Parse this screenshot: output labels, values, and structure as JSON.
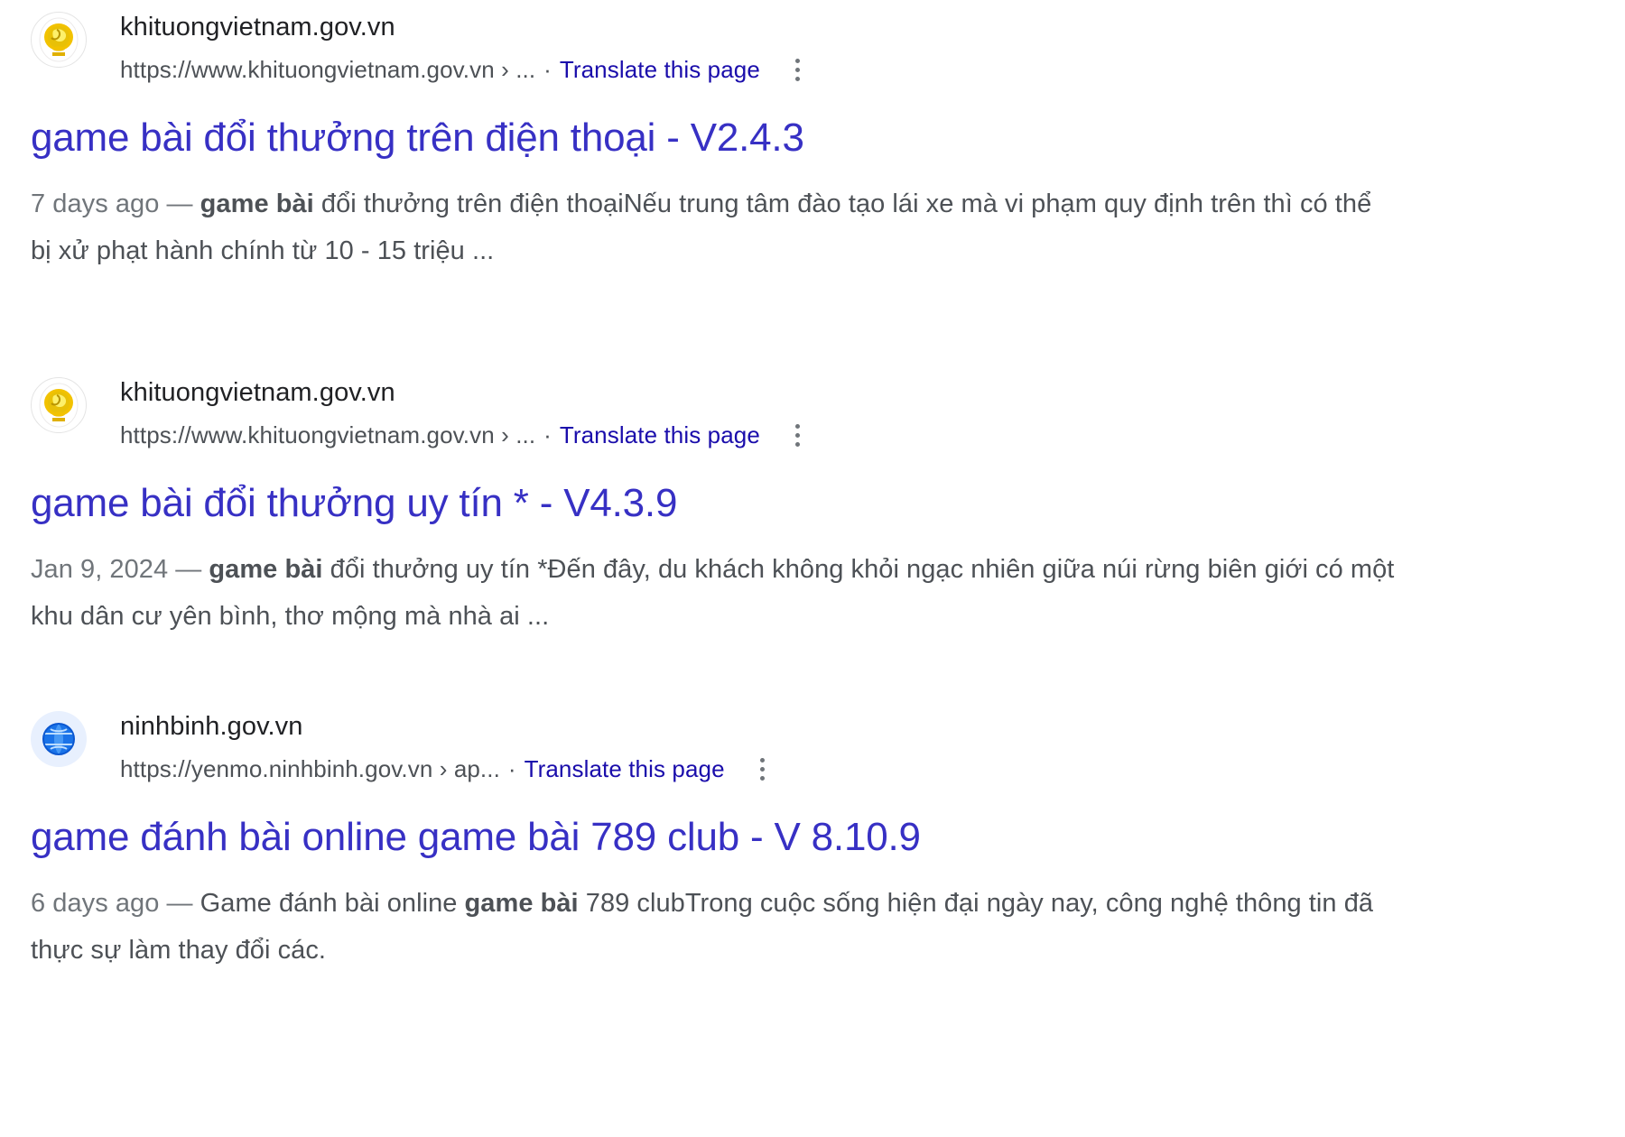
{
  "page": {
    "background_color": "#ffffff",
    "title_color": "#3730c4",
    "link_color": "#1a0dab",
    "snippet_color": "#4d5156",
    "date_color": "#70757a"
  },
  "results": [
    {
      "favicon": "gold-emblem-icon",
      "site_name": "khituongvietnam.gov.vn",
      "url": "https://www.khituongvietnam.gov.vn › ...",
      "separator": "·",
      "translate_label": "Translate this page",
      "menu_icon": "kebab-menu-icon",
      "title": "game bài đổi thưởng trên điện thoại - V2.4.3",
      "snippet": {
        "date": "7 days ago",
        "dash": "—",
        "bold": "game bài",
        "text": " đổi thưởng trên điện thoạiNếu trung tâm đào tạo lái xe mà vi phạm quy định trên thì có thể bị xử phạt hành chính từ 10 - 15 triệu ..."
      }
    },
    {
      "favicon": "gold-emblem-icon",
      "site_name": "khituongvietnam.gov.vn",
      "url": "https://www.khituongvietnam.gov.vn › ...",
      "separator": "·",
      "translate_label": "Translate this page",
      "menu_icon": "kebab-menu-icon",
      "title": "game bài đổi thưởng uy tín * - V4.3.9",
      "snippet": {
        "date": "Jan 9, 2024",
        "dash": "—",
        "bold": "game bài",
        "text": " đổi thưởng uy tín *Đến đây, du khách không khỏi ngạc nhiên giữa núi rừng biên giới có một khu dân cư yên bình, thơ mộng mà nhà ai ..."
      }
    },
    {
      "favicon": "globe-icon",
      "site_name": "ninhbinh.gov.vn",
      "url": "https://yenmo.ninhbinh.gov.vn › ap...",
      "separator": "·",
      "translate_label": "Translate this page",
      "menu_icon": "kebab-menu-icon",
      "title": "game đánh bài online game bài 789 club - V 8.10.9",
      "snippet": {
        "date": "6 days ago",
        "dash": "—",
        "bold": "game bài",
        "pre_bold": "Game đánh bài online ",
        "text": " 789 clubTrong cuộc sống hiện đại ngày nay, công nghệ thông tin đã thực sự làm thay đổi các."
      }
    }
  ]
}
